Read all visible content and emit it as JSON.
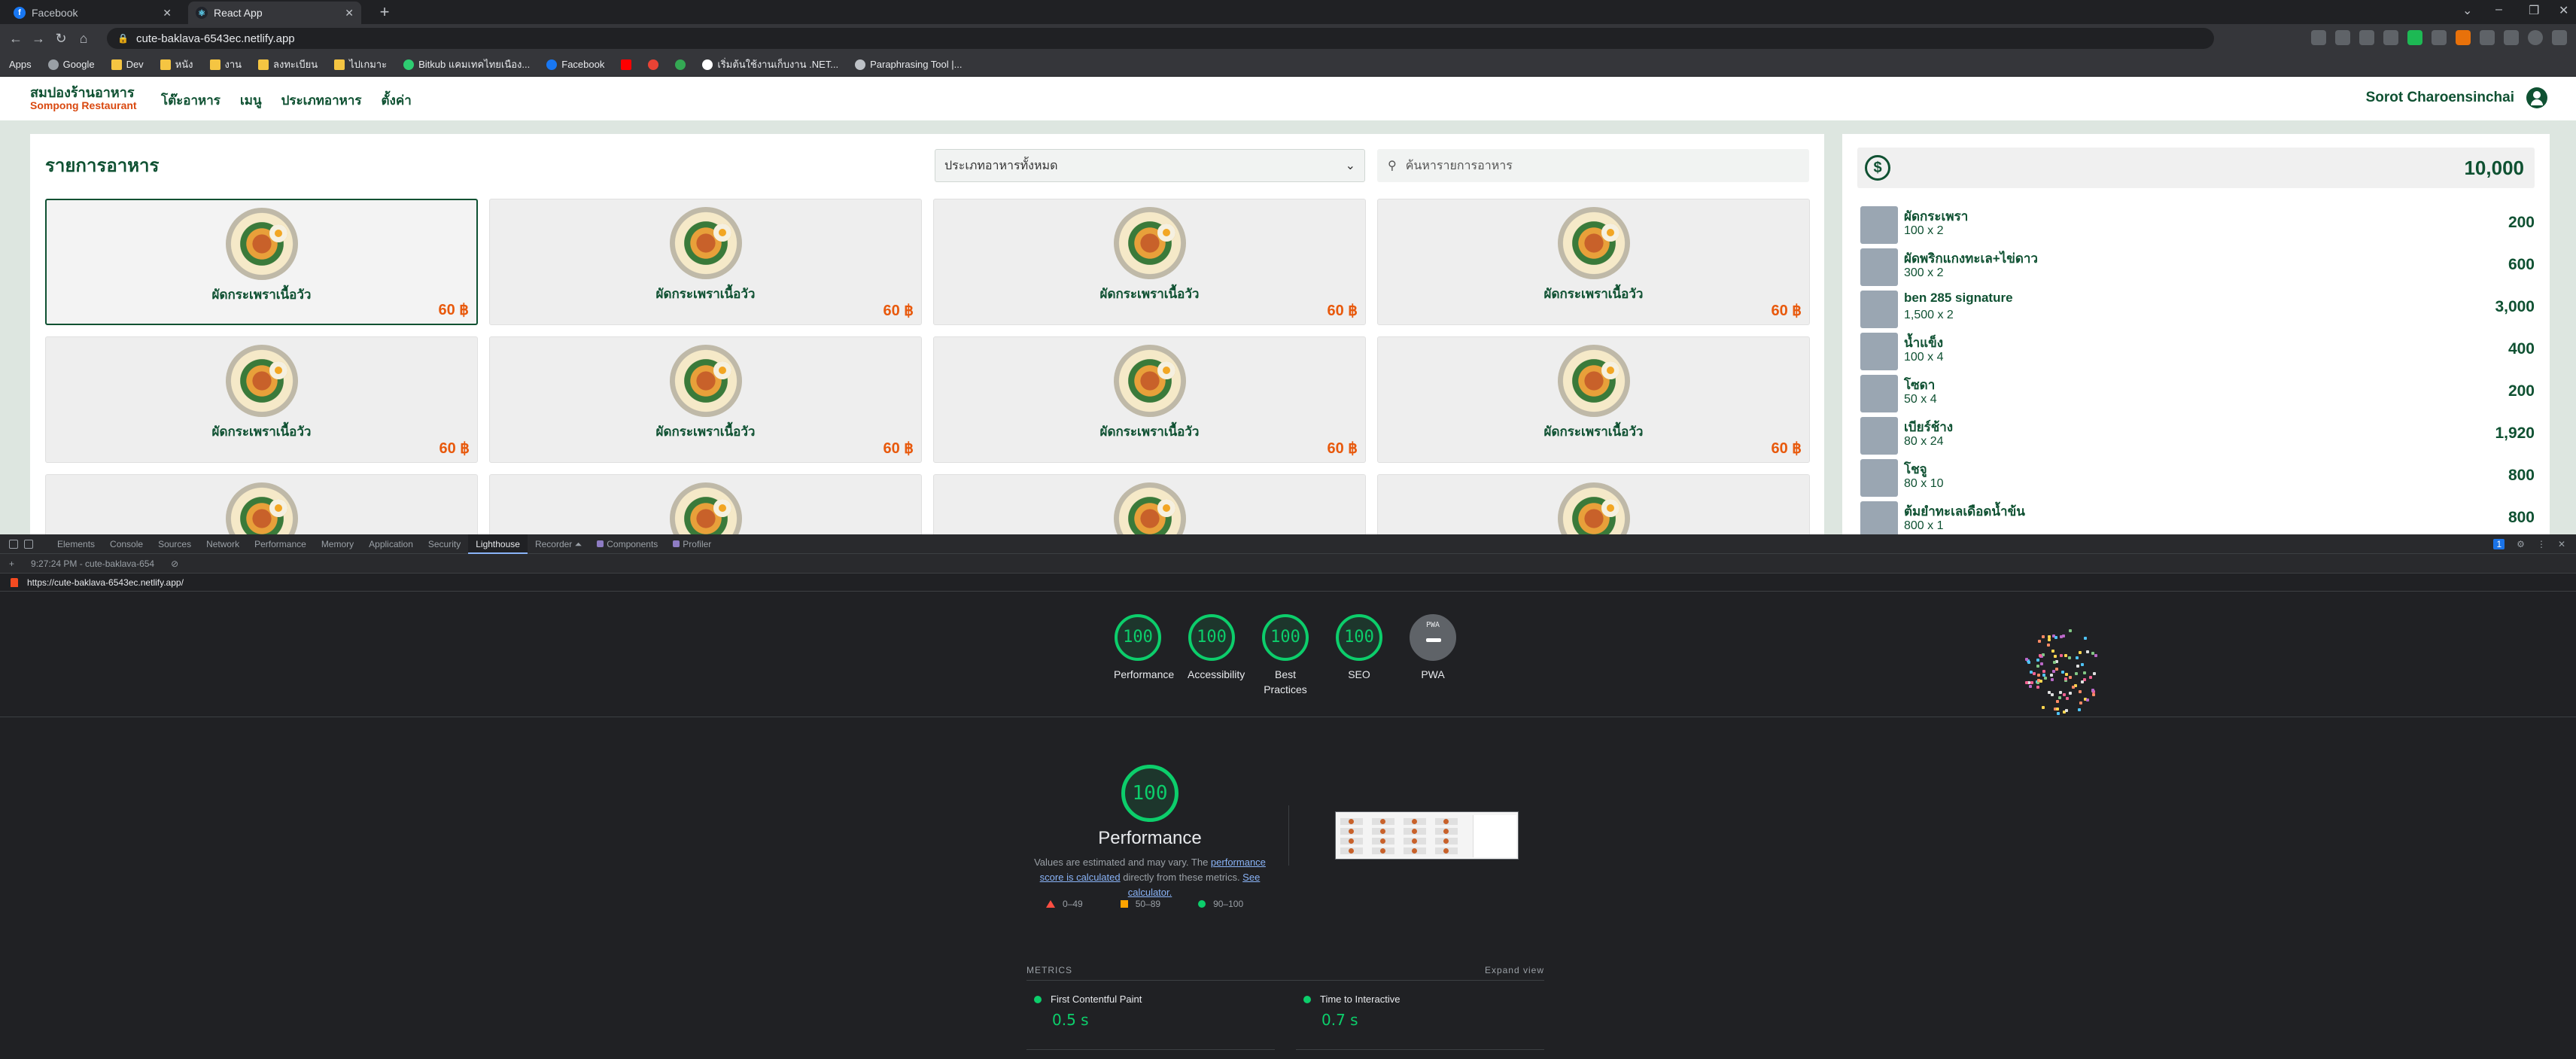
{
  "browser": {
    "tabs": [
      {
        "title": "Facebook",
        "active": false
      },
      {
        "title": "React App",
        "active": true
      }
    ],
    "url": "cute-baklava-6543ec.netlify.app",
    "bookmarks": [
      "Apps",
      "Google",
      "Dev",
      "หนัง",
      "งาน",
      "ลงทะเบียน",
      "ไปเกมาะ",
      "Bitkub แคมเทคไทยเนือง...",
      "Facebook",
      "เริ่มต้นใช้งานเก็บงาน .NET...",
      "Paraphrasing Tool |..."
    ]
  },
  "app": {
    "brand_th": "สมปองร้านอาหาร",
    "brand_en": "Sompong Restaurant",
    "nav": [
      "โต๊ะอาหาร",
      "เมนู",
      "ประเภทอาหาร",
      "ตั้งค่า"
    ],
    "user_name": "Sorot Charoensinchai",
    "menu_title": "รายการอาหาร",
    "category_select": "ประเภทอาหารทั้งหมด",
    "search_placeholder": "ค้นหารายการอาหาร",
    "dish_name": "ผัดกระเพราเนื้อวัว",
    "dish_price": "60 ฿",
    "cart_total": "10,000",
    "cart_items": [
      {
        "name": "ผัดกระเพรา",
        "qty": "100 x 2",
        "sum": "200"
      },
      {
        "name": "ผัดพริกแกงทะเล+ไข่ดาว",
        "qty": "300 x 2",
        "sum": "600"
      },
      {
        "name": "ben 285 signature",
        "qty": "1,500 x 2",
        "sum": "3,000"
      },
      {
        "name": "น้ำแข็ง",
        "qty": "100 x 4",
        "sum": "400"
      },
      {
        "name": "โซดา",
        "qty": "50 x 4",
        "sum": "200"
      },
      {
        "name": "เบียร์ช้าง",
        "qty": "80 x 24",
        "sum": "1,920"
      },
      {
        "name": "โชจู",
        "qty": "80 x 10",
        "sum": "800"
      },
      {
        "name": "ต้มยำทะเลเดือดน้ำข้น",
        "qty": "800 x 1",
        "sum": "800"
      }
    ]
  },
  "devtools": {
    "tabs": [
      "Elements",
      "Console",
      "Sources",
      "Network",
      "Performance",
      "Memory",
      "Application",
      "Security",
      "Lighthouse",
      "Recorder ⏶",
      "Components",
      "Profiler"
    ],
    "active_tab": "Lighthouse",
    "report_time": "9:27:24 PM - cute-baklava-654",
    "report_url": "https://cute-baklava-6543ec.netlify.app/",
    "scores": [
      {
        "label": "Performance",
        "value": "100"
      },
      {
        "label": "Accessibility",
        "value": "100"
      },
      {
        "label": "Best Practices",
        "value": "100"
      },
      {
        "label": "SEO",
        "value": "100"
      }
    ],
    "pwa_label": "PWA",
    "perf_score": "100",
    "perf_title": "Performance",
    "perf_desc_1": "Values are estimated and may vary. The ",
    "perf_desc_link": "performance score is calculated",
    "perf_desc_2": " directly from these metrics. ",
    "perf_desc_link2": "See calculator.",
    "legend": [
      "0–49",
      "50–89",
      "90–100"
    ],
    "metrics_label": "METRICS",
    "expand_view": "Expand view",
    "metrics": [
      {
        "name": "First Contentful Paint",
        "value": "0.5 s"
      },
      {
        "name": "Time to Interactive",
        "value": "0.7 s"
      }
    ],
    "colors": {
      "pass": "#0cce6b",
      "average": "#ffa400",
      "fail": "#ff4e42"
    }
  }
}
